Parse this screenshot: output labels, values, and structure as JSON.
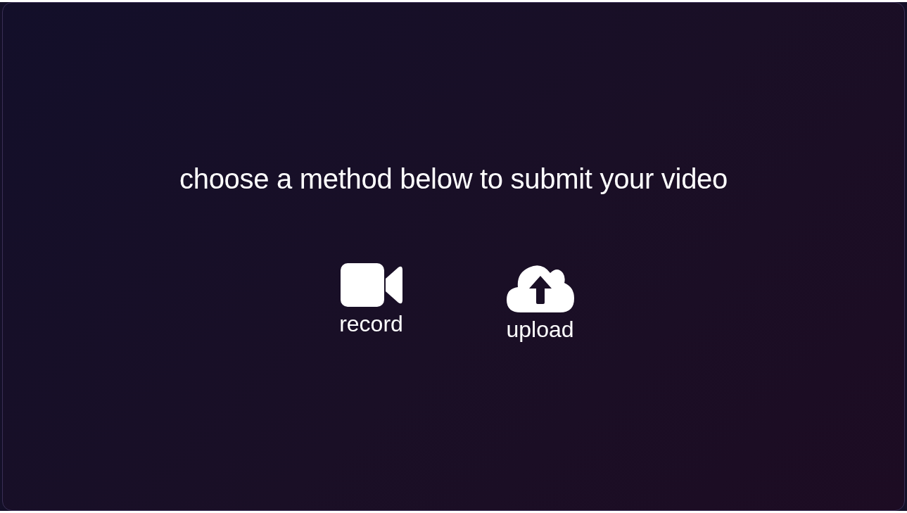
{
  "prompt": "choose a method below to submit your video",
  "methods": [
    {
      "kind": "record",
      "label": "record"
    },
    {
      "kind": "upload",
      "label": "upload"
    }
  ]
}
